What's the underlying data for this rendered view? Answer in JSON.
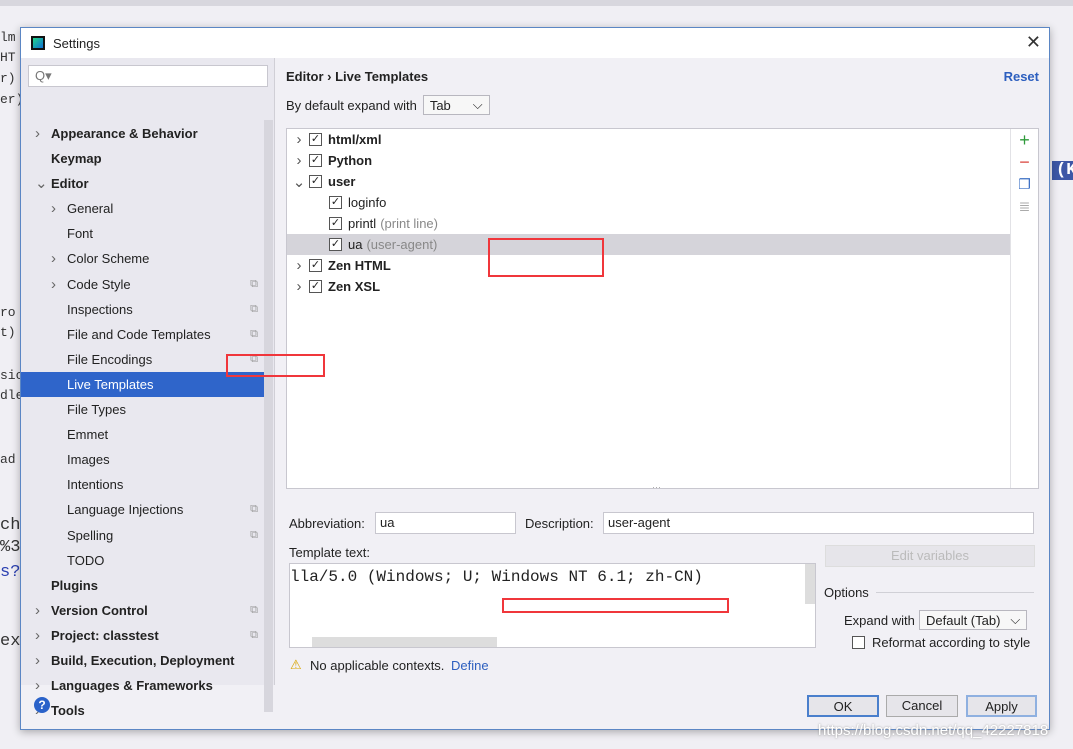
{
  "background": {
    "fragments": [
      "lm",
      "HT",
      "r)",
      "er)",
      "ro",
      "t)",
      "sic",
      "dle",
      "ad",
      "che",
      "%3",
      "s?i",
      "ex",
      "(K"
    ]
  },
  "dialog": {
    "title": "Settings",
    "close_icon": "close-icon"
  },
  "sidebar": {
    "search_placeholder": "Q▾",
    "items": [
      {
        "label": "Appearance & Behavior",
        "bold": true,
        "arrow": ">",
        "level": 0
      },
      {
        "label": "Keymap",
        "bold": true,
        "arrow": "",
        "level": 0
      },
      {
        "label": "Editor",
        "bold": true,
        "arrow": "v",
        "level": 0
      },
      {
        "label": "General",
        "arrow": ">",
        "level": 1
      },
      {
        "label": "Font",
        "arrow": "",
        "level": 1
      },
      {
        "label": "Color Scheme",
        "arrow": ">",
        "level": 1
      },
      {
        "label": "Code Style",
        "arrow": ">",
        "level": 1,
        "copy": true
      },
      {
        "label": "Inspections",
        "arrow": "",
        "level": 1,
        "copy": true
      },
      {
        "label": "File and Code Templates",
        "arrow": "",
        "level": 1,
        "copy": true
      },
      {
        "label": "File Encodings",
        "arrow": "",
        "level": 1,
        "copy": true
      },
      {
        "label": "Live Templates",
        "arrow": "",
        "level": 1,
        "selected": true
      },
      {
        "label": "File Types",
        "arrow": "",
        "level": 1
      },
      {
        "label": "Emmet",
        "arrow": "",
        "level": 1
      },
      {
        "label": "Images",
        "arrow": "",
        "level": 1
      },
      {
        "label": "Intentions",
        "arrow": "",
        "level": 1
      },
      {
        "label": "Language Injections",
        "arrow": "",
        "level": 1,
        "copy": true
      },
      {
        "label": "Spelling",
        "arrow": "",
        "level": 1,
        "copy": true
      },
      {
        "label": "TODO",
        "arrow": "",
        "level": 1
      },
      {
        "label": "Plugins",
        "bold": true,
        "arrow": "",
        "level": 0
      },
      {
        "label": "Version Control",
        "bold": true,
        "arrow": ">",
        "level": 0,
        "copy": true
      },
      {
        "label": "Project: classtest",
        "bold": true,
        "arrow": ">",
        "level": 0,
        "copy": true
      },
      {
        "label": "Build, Execution, Deployment",
        "bold": true,
        "arrow": ">",
        "level": 0
      },
      {
        "label": "Languages & Frameworks",
        "bold": true,
        "arrow": ">",
        "level": 0
      },
      {
        "label": "Tools",
        "bold": true,
        "arrow": ">",
        "level": 0
      }
    ]
  },
  "main": {
    "breadcrumb": "Editor  ›  Live Templates",
    "reset": "Reset",
    "expand_label": "By default expand with",
    "expand_value": "Tab",
    "tree": [
      {
        "label": "html/xml",
        "bold": true,
        "arrow": ">",
        "level": 0,
        "checked": true
      },
      {
        "label": "Python",
        "bold": true,
        "arrow": ">",
        "level": 0,
        "checked": true
      },
      {
        "label": "user",
        "bold": true,
        "arrow": "v",
        "level": 0,
        "checked": true
      },
      {
        "label": "loginfo",
        "level": 1,
        "checked": true,
        "hint": ""
      },
      {
        "label": "printl",
        "level": 1,
        "checked": true,
        "hint": "(print line)"
      },
      {
        "label": "ua",
        "level": 1,
        "checked": true,
        "hint": "(user-agent)",
        "selected": true
      },
      {
        "label": "Zen HTML",
        "bold": true,
        "arrow": ">",
        "level": 0,
        "checked": true
      },
      {
        "label": "Zen XSL",
        "bold": true,
        "arrow": ">",
        "level": 0,
        "checked": true
      }
    ],
    "tools": [
      {
        "icon": "add-icon",
        "glyph": "+",
        "color": "#2e9a3a"
      },
      {
        "icon": "remove-icon",
        "glyph": "−",
        "color": "#d9473f"
      },
      {
        "icon": "copy-icon",
        "glyph": "❐",
        "color": "#3b6fc4"
      },
      {
        "icon": "list-icon",
        "glyph": "≣",
        "color": "#aaa"
      }
    ],
    "abbreviation_label": "Abbreviation:",
    "abbreviation": "ua",
    "description_label": "Description:",
    "description": "user-agent",
    "template_label": "Template text:",
    "template_text": "lla/5.0 (Windows; U; Windows NT 6.1; zh-CN)",
    "edit_variables": "Edit variables",
    "options_label": "Options",
    "expand_with_label": "Expand with",
    "expand_with_value": "Default (Tab)",
    "reformat_label": "Reformat according to style",
    "reformat_checked": false,
    "warning": "No applicable contexts.",
    "define": "Define"
  },
  "footer": {
    "ok": "OK",
    "cancel": "Cancel",
    "apply": "Apply",
    "help": "?"
  },
  "watermark": "https://blog.csdn.net/qq_42227818"
}
